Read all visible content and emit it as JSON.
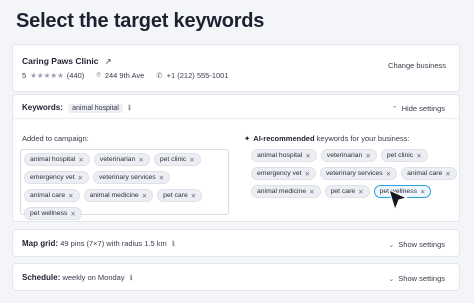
{
  "page": {
    "title": "Select the target keywords"
  },
  "business": {
    "name": "Caring Paws Clinic",
    "rating": "5",
    "stars": "★★★★★",
    "reviews": "(440)",
    "address": "244 9th Ave",
    "phone": "+1 (212) 555-1001",
    "change_label": "Change business"
  },
  "keywords": {
    "label": "Keywords:",
    "header_chip": "animal hospital",
    "toggle_label": "Hide settings",
    "added_label": "Added to campaign:",
    "ai_label_bold": "AI-recommended",
    "ai_label_rest": " keywords for your business:",
    "added": [
      "animal hospital",
      "veterinarian",
      "pet clinic",
      "emergency vet",
      "veterinary services",
      "animal care",
      "animal medicine",
      "pet care",
      "pet wellness"
    ],
    "ai": [
      "animal hospital",
      "veterinarian",
      "pet clinic",
      "emergency vet",
      "veterinary services",
      "animal care",
      "animal medicine",
      "pet care",
      "pet wellness"
    ],
    "selected_ai_index": 8,
    "selected_color": "#2c9fda"
  },
  "map_grid": {
    "label": "Map grid:",
    "value": "49 pins (7×7) with radius 1.5 km",
    "toggle_label": "Show settings"
  },
  "schedule": {
    "label": "Schedule:",
    "value": "weekly on Monday",
    "toggle_label": "Show settings"
  },
  "icons": {
    "external_link": "external-link-icon",
    "location": "map-pin-icon",
    "phone": "phone-icon",
    "info": "info-icon",
    "chevron_up": "chevron-up-icon",
    "chevron_down": "chevron-down-icon",
    "ai": "sparkle-icon",
    "remove": "close-icon",
    "cursor": "mouse-pointer-icon"
  }
}
